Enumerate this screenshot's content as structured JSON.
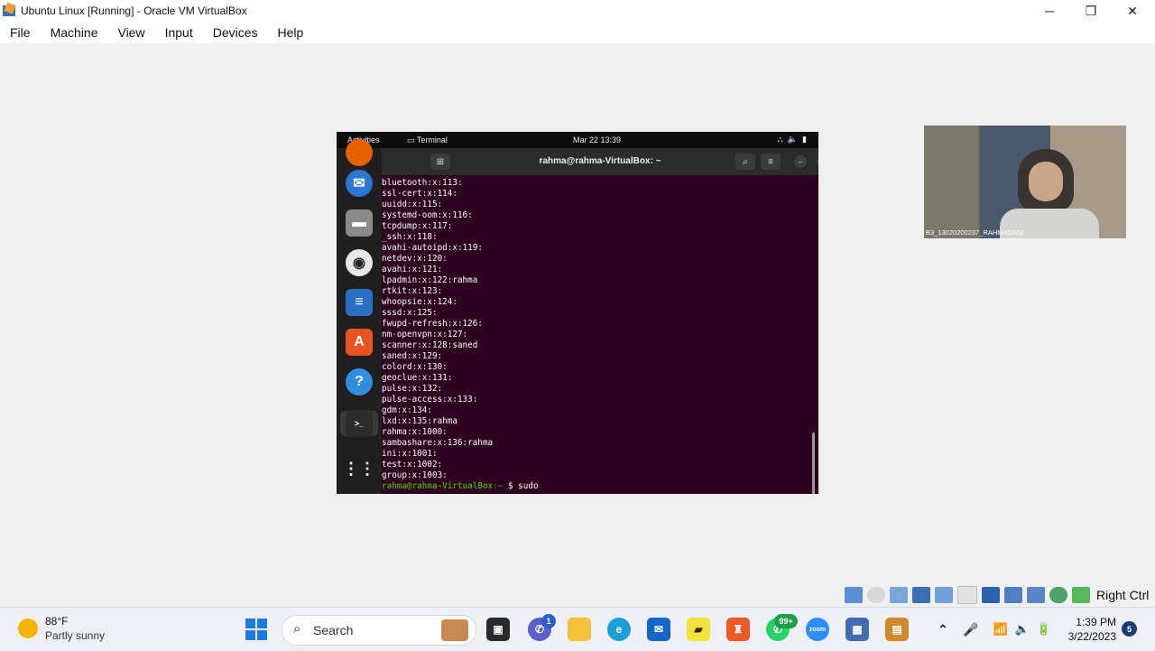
{
  "window": {
    "title": "Ubuntu Linux [Running] - Oracle VM VirtualBox",
    "minimize": "─",
    "maximize": "❐",
    "close": "✕"
  },
  "menu": [
    "File",
    "Machine",
    "View",
    "Input",
    "Devices",
    "Help"
  ],
  "ubuntu": {
    "activities": "Activities",
    "app": "Terminal",
    "clock": "Mar 22  13:39",
    "terminal_title": "rahma@rahma-VirtualBox: ~",
    "lines": [
      "bluetooth:x:113:",
      "ssl-cert:x:114:",
      "uuidd:x:115:",
      "systemd-oom:x:116:",
      "tcpdump:x:117:",
      "_ssh:x:118:",
      "avahi-autoipd:x:119:",
      "netdev:x:120:",
      "avahi:x:121:",
      "lpadmin:x:122:rahma",
      "rtkit:x:123:",
      "whoopsie:x:124:",
      "sssd:x:125:",
      "fwupd-refresh:x:126:",
      "nm-openvpn:x:127:",
      "scanner:x:128:saned",
      "saned:x:129:",
      "colord:x:130:",
      "geoclue:x:131:",
      "pulse:x:132:",
      "pulse-access:x:133:",
      "gdm:x:134:",
      "lxd:x:135:rahma",
      "rahma:x:1000:",
      "sambashare:x:136:rahma",
      "ini:x:1001:",
      "test:x:1002:",
      "group:x:1003:"
    ],
    "prompt_user": "rahma@rahma-VirtualBox",
    "prompt_path": ":~",
    "prompt_cmd": "$ sudo"
  },
  "webcam": {
    "label": "B3_13020200237_RAHMADANI"
  },
  "vbox_status": {
    "host_key": "Right Ctrl"
  },
  "taskbar": {
    "temp": "88°F",
    "weather": "Partly sunny",
    "search": "Search",
    "chat_badge": "1",
    "whatsapp_badge": "99+",
    "zoom_label": "zoom",
    "time": "1:39 PM",
    "date": "3/22/2023",
    "notifications": "5"
  }
}
